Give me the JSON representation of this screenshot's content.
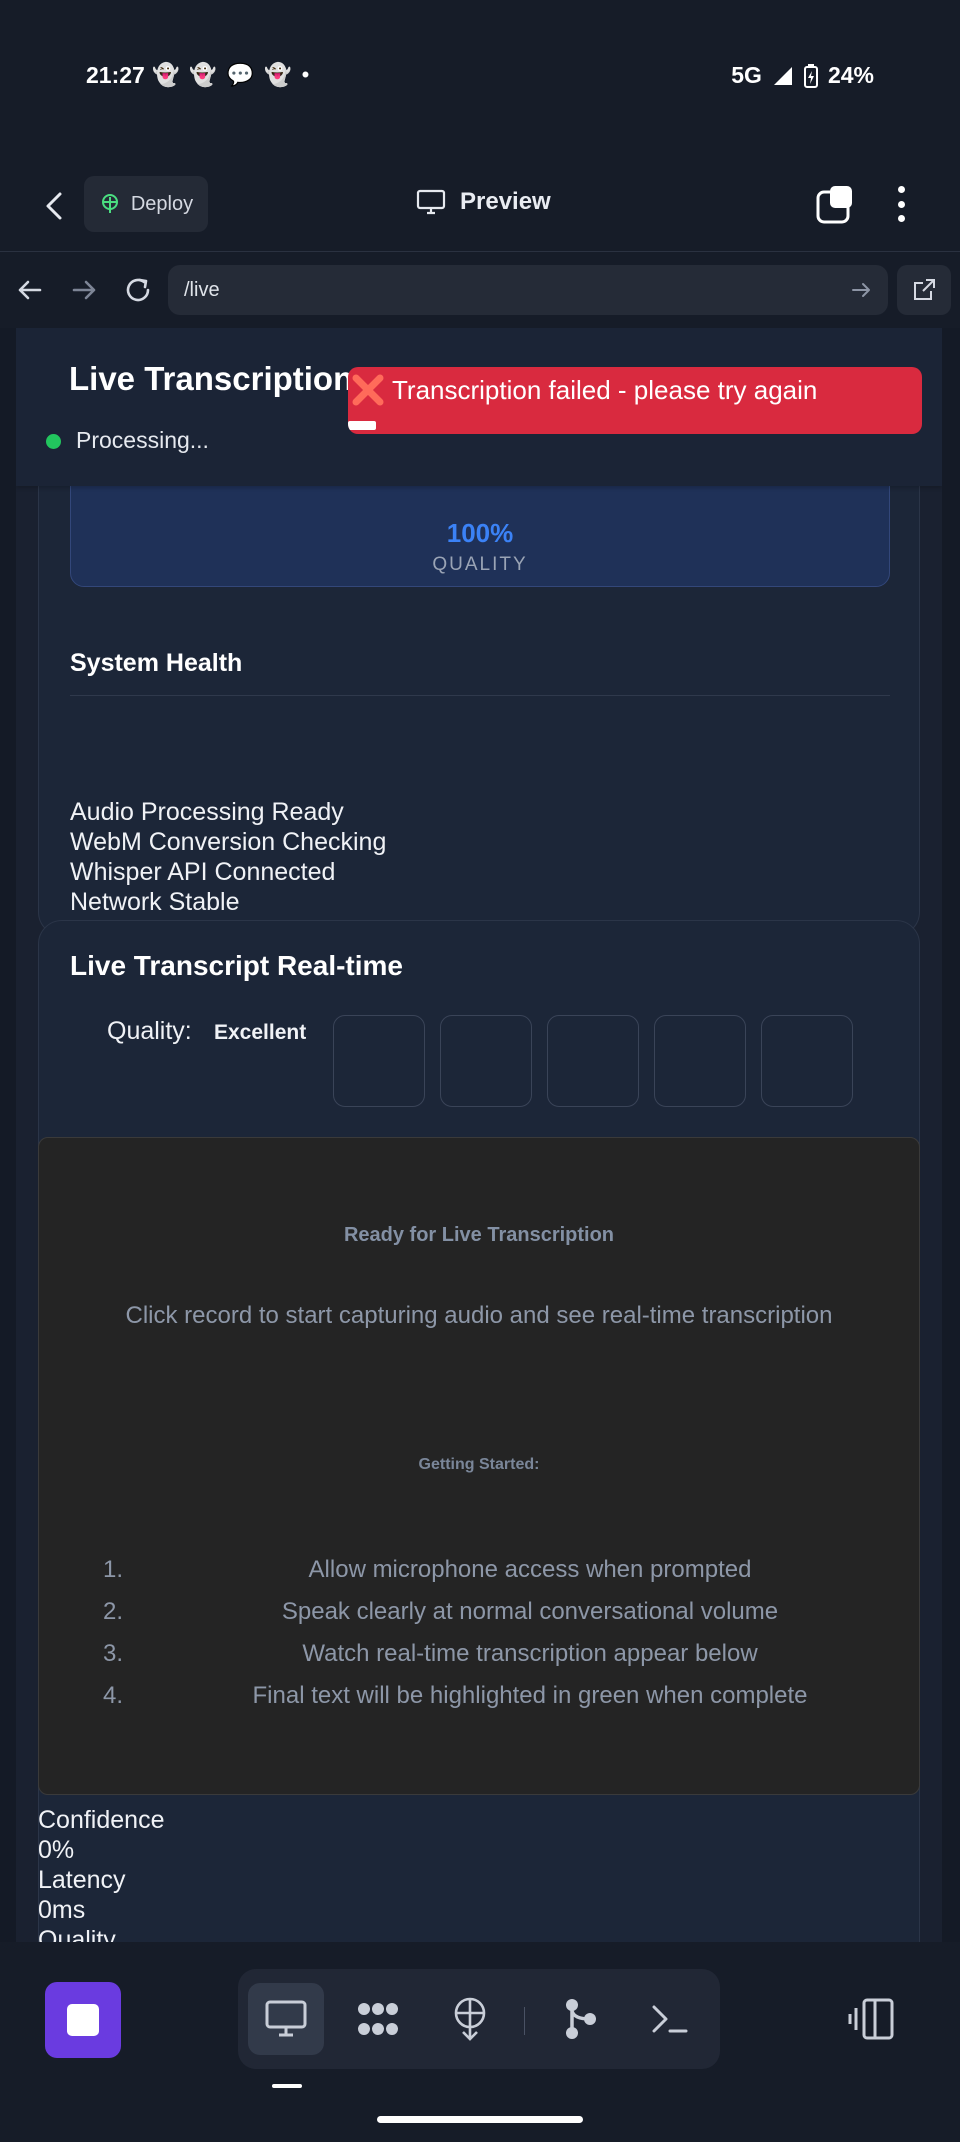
{
  "status_bar": {
    "time": "21:27",
    "notification_icons": [
      "snapchat-icon",
      "snapchat-icon",
      "messenger-icon",
      "snapchat-icon",
      "dot-icon"
    ],
    "network": "5G",
    "battery": "24%"
  },
  "app_bar": {
    "deploy_label": "Deploy",
    "preview_label": "Preview"
  },
  "url_bar": {
    "url": "/live"
  },
  "page": {
    "title": "Live Transcription",
    "status": "Processing...",
    "toast": "Transcription failed - please try again",
    "quality_value": "100%",
    "quality_label": "QUALITY",
    "health_title": "System Health",
    "health_items": [
      "Audio Processing Ready",
      "WebM Conversion Checking",
      "Whisper API Connected",
      "Network Stable"
    ],
    "transcript_title": "Live Transcript Real-time",
    "quality_text": "Quality:",
    "quality_rating": "Excellent",
    "ready_title": "Ready for Live Transcription",
    "ready_sub": "Click record to start capturing audio and see real-time transcription",
    "getting_started": "Getting Started:",
    "steps": [
      {
        "num": "1.",
        "text": "Allow microphone access when prompted"
      },
      {
        "num": "2.",
        "text": "Speak clearly at normal conversational volume"
      },
      {
        "num": "3.",
        "text": "Watch real-time transcription appear below"
      },
      {
        "num": "4.",
        "text": "Final text will be highlighted in green when complete"
      }
    ],
    "stats": {
      "confidence_label": "Confidence",
      "confidence_value": "0%",
      "latency_label": "Latency",
      "latency_value": "0ms",
      "quality_label": "Quality"
    }
  },
  "bottom_nav": {
    "tools": [
      "desktop-icon",
      "agents-icon",
      "deploy-icon",
      "git-icon",
      "terminal-icon"
    ],
    "active_tool": "desktop-icon"
  },
  "colors": {
    "accent": "#6a3be0",
    "error": "#d92a3f",
    "success": "#22c55e",
    "quality_blue": "#3b82f6"
  }
}
